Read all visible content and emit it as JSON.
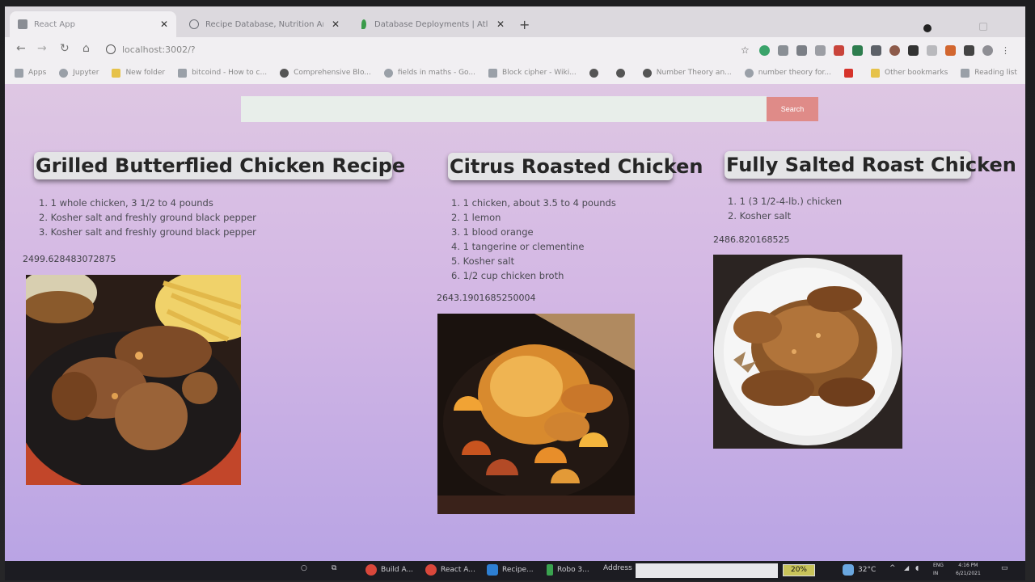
{
  "browser": {
    "tabs": [
      {
        "title": "React App"
      },
      {
        "title": "Recipe Database, Nutrition Anal..."
      },
      {
        "title": "Database Deployments | Atlas: M..."
      }
    ],
    "new_tab_label": "+",
    "url": "localhost:3002/?",
    "bookmarks": [
      {
        "label": "Apps",
        "icon": "apps-grid-icon"
      },
      {
        "label": "Jupyter",
        "icon": "jupyter-icon"
      },
      {
        "label": "New folder",
        "icon": "folder-icon"
      },
      {
        "label": "bitcoind - How to c...",
        "icon": "bookmark-icon"
      },
      {
        "label": "Comprehensive Blo...",
        "icon": "globe-icon"
      },
      {
        "label": "fields in maths - Go...",
        "icon": "google-icon"
      },
      {
        "label": "Block cipher - Wiki...",
        "icon": "wikipedia-icon"
      },
      {
        "label": "",
        "icon": "globe-icon"
      },
      {
        "label": "",
        "icon": "globe-icon"
      },
      {
        "label": "Number Theory an...",
        "icon": "globe-icon"
      },
      {
        "label": "number theory for...",
        "icon": "google-icon"
      },
      {
        "label": "",
        "icon": "youtube-icon"
      },
      {
        "label": "Other bookmarks",
        "icon": "folder-icon"
      },
      {
        "label": "Reading list",
        "icon": "reading-list-icon"
      }
    ],
    "colors": {
      "tabbar": "#dcd9de",
      "toolbar": "#f1eff2"
    }
  },
  "search": {
    "placeholder": "",
    "value": "",
    "button_label": "Search",
    "button_color": "#df8b88"
  },
  "recipes": [
    {
      "title": "Grilled Butterflied Chicken Recipe",
      "ingredients": [
        "1. 1 whole chicken, 3 1/2 to 4 pounds",
        "2. Kosher salt and freshly ground black pepper",
        "3. Kosher salt and freshly ground black pepper"
      ],
      "calories": "2499.628483072875",
      "image": "grilled-chicken-photo"
    },
    {
      "title": "Citrus Roasted Chicken",
      "ingredients": [
        "1. 1 chicken, about 3.5 to 4 pounds",
        "2. 1 lemon",
        "3. 1 blood orange",
        "4. 1 tangerine or clementine",
        "5. Kosher salt",
        "6. 1/2 cup chicken broth"
      ],
      "calories": "2643.1901685250004",
      "image": "citrus-roast-chicken-photo"
    },
    {
      "title": "Fully Salted Roast Chicken",
      "ingredients": [
        "1. 1 (3 1/2-4-lb.) chicken",
        "2. Kosher salt"
      ],
      "calories": "2486.820168525",
      "image": "salted-roast-chicken-photo"
    }
  ],
  "taskbar": {
    "items": [
      {
        "label": "Build A...",
        "icon": "chrome-icon"
      },
      {
        "label": "React A...",
        "icon": "chrome-icon"
      },
      {
        "label": "Recipe...",
        "icon": "vscode-icon"
      },
      {
        "label": "Robo 3...",
        "icon": "robo3t-icon"
      }
    ],
    "address_label": "Address",
    "battery": "20%",
    "temperature": "32°C",
    "language": "ENG",
    "language_region": "IN",
    "time": "4:16 PM",
    "date": "6/21/2021"
  }
}
